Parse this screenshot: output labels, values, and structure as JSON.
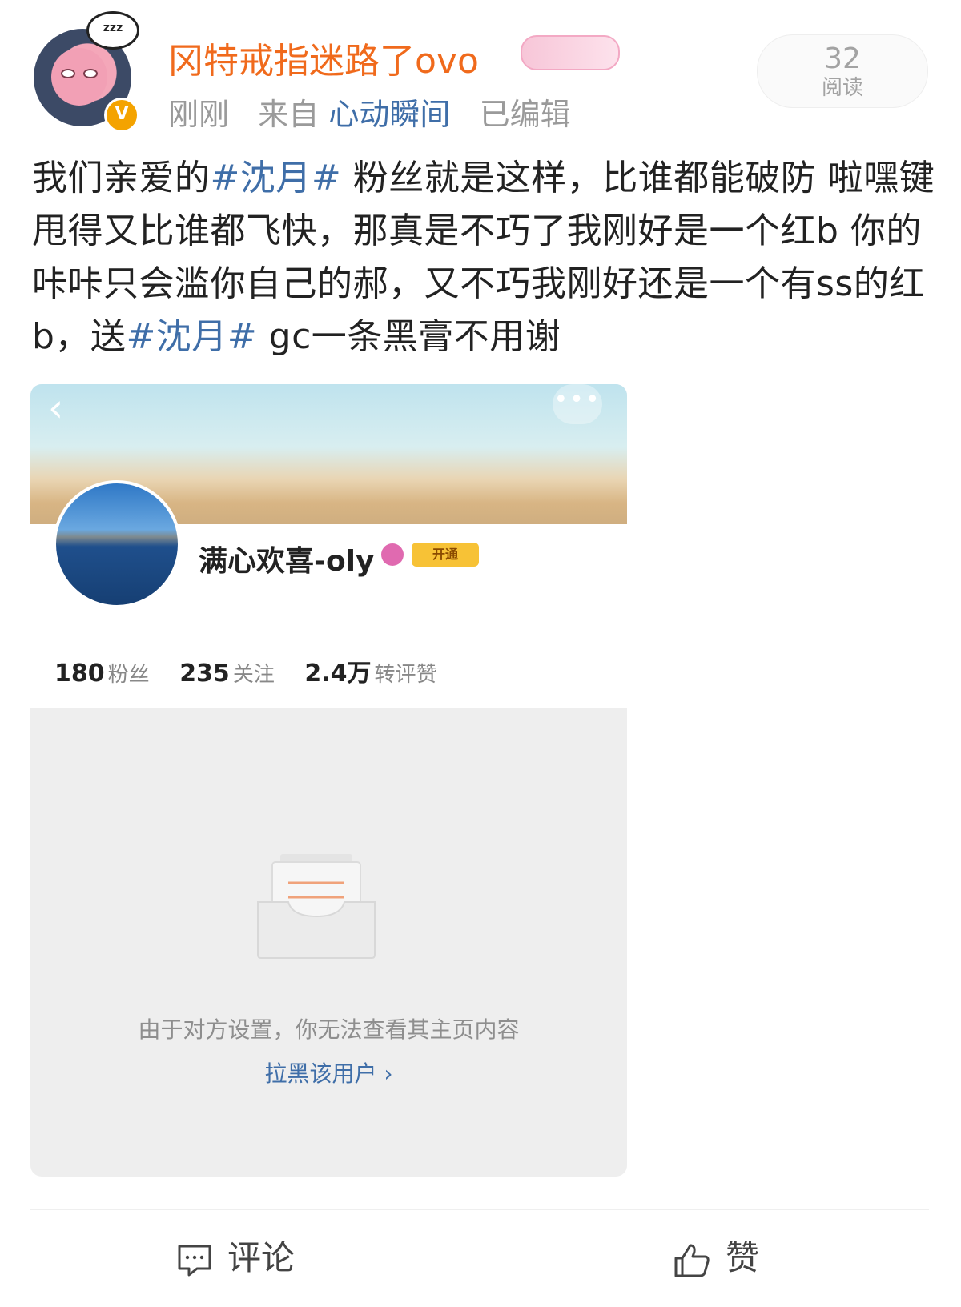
{
  "header": {
    "avatar_bubble": "zzz",
    "username": "冈特戒指迷路了ovo",
    "verified_badge": "V",
    "time": "刚刚",
    "source_prefix": "来自",
    "source": "心动瞬间",
    "edited": "已编辑",
    "read_count": "32",
    "read_label": "阅读"
  },
  "post": {
    "seg1": "我们亲爱的",
    "tag1": "#沈月#",
    "seg2": " 粉丝就是这样，比谁都能破防 啦嘿键甩得又比谁都飞快，那真是不巧了我刚好是一个红b 你的咔咔只会滥你自己的郝，又不巧我刚好还是一个有ss的红b，送",
    "tag2": "#沈月#",
    "seg3": " gc一条黑膏不用谢"
  },
  "embedded_profile": {
    "back_glyph": "‹",
    "more_glyph": "•••",
    "name": "满心欢喜-oly",
    "vip_badge": "开通",
    "stats": [
      {
        "value": "180",
        "label": "粉丝"
      },
      {
        "value": "235",
        "label": "关注"
      },
      {
        "value": "2.4万",
        "label": "转评赞"
      }
    ],
    "empty_message": "由于对方设置，你无法查看其主页内容",
    "block_link": "拉黑该用户 ›"
  },
  "footer": {
    "comment_label": "评论",
    "like_label": "赞"
  },
  "colors": {
    "username": "#f06a1c",
    "link": "#3f6ea8",
    "muted": "#9a9a9a"
  },
  "icons": [
    "comment-icon",
    "thumbs-up-icon",
    "empty-inbox-icon",
    "back-chevron-icon",
    "more-dots-icon"
  ]
}
